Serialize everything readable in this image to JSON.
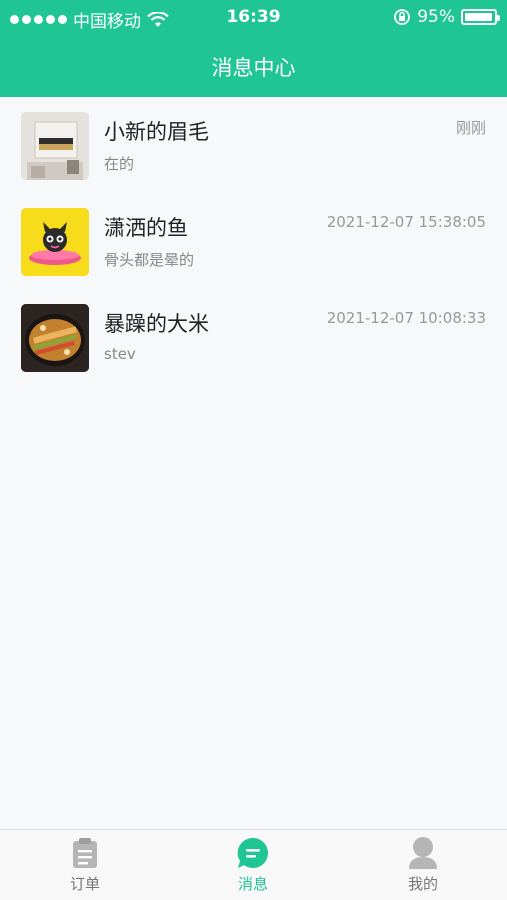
{
  "status_bar": {
    "carrier": "中国移动",
    "time": "16:39",
    "battery_text": "95%",
    "battery_level": 0.95,
    "signal_bars": 5
  },
  "header": {
    "title": "消息中心"
  },
  "messages": [
    {
      "name": "小新的眉毛",
      "preview": "在的",
      "time": "刚刚"
    },
    {
      "name": "潇洒的鱼",
      "preview": "骨头都是晕的",
      "time": "2021-12-07 15:38:05"
    },
    {
      "name": "暴躁的大米",
      "preview": "stev",
      "time": "2021-12-07 10:08:33"
    }
  ],
  "tabbar": {
    "tabs": [
      {
        "label": "订单",
        "icon": "clipboard-icon",
        "active": false
      },
      {
        "label": "消息",
        "icon": "chat-bubble-icon",
        "active": true
      },
      {
        "label": "我的",
        "icon": "user-icon",
        "active": false
      }
    ]
  },
  "colors": {
    "brand": "#1fc693",
    "inactive": "#b5b5b5"
  }
}
